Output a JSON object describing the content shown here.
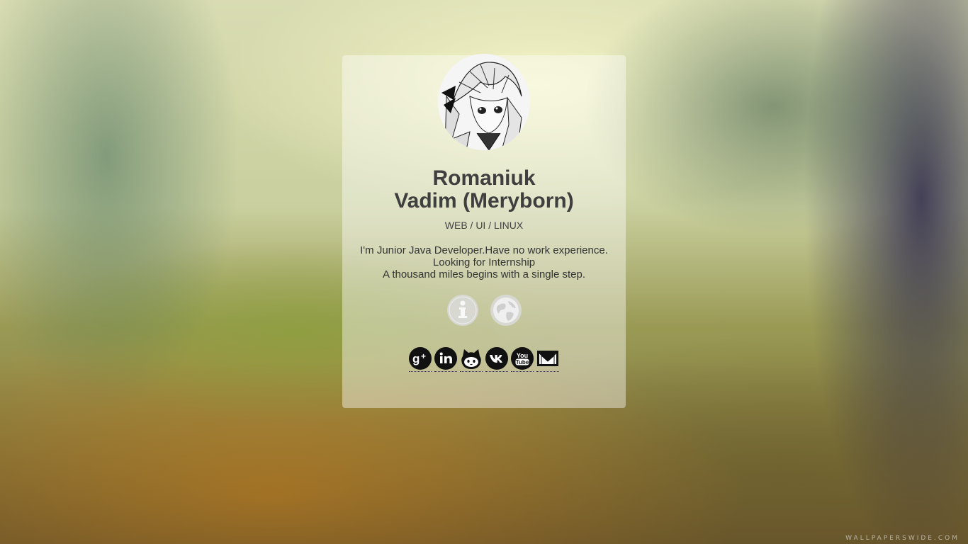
{
  "profile": {
    "name_line1": "Romaniuk",
    "name_line2": "Vadim (Meryborn)",
    "tagline": "WEB / UI / LINUX",
    "bio_lines": [
      "I'm Junior Java Developer.Have no work experience.",
      "Looking for Internship",
      "A thousand miles begins with a single step."
    ]
  },
  "action_buttons": [
    {
      "icon": "info-icon"
    },
    {
      "icon": "globe-icon"
    }
  ],
  "social_links": [
    {
      "icon": "google-plus-icon"
    },
    {
      "icon": "linkedin-icon"
    },
    {
      "icon": "github-icon"
    },
    {
      "icon": "vk-icon"
    },
    {
      "icon": "youtube-icon"
    },
    {
      "icon": "email-icon"
    }
  ],
  "watermark": "WALLPAPERSWIDE.COM",
  "colors": {
    "card_background": "rgba(255,255,255,0.42)",
    "text_dark": "#3f3f3f",
    "icon_dark": "#111111",
    "icon_light": "#d9d9d9"
  }
}
